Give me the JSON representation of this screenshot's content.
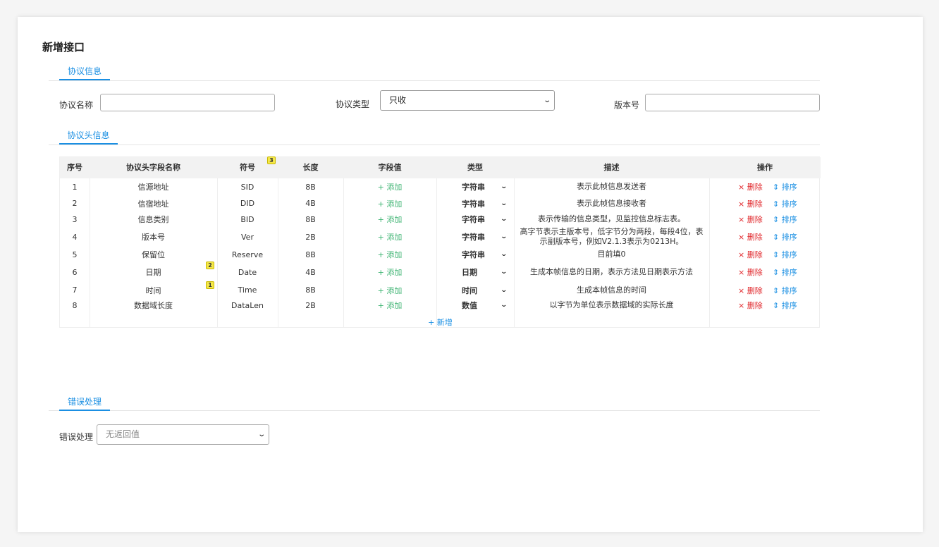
{
  "page_title": "新增接口",
  "sections": {
    "protocol_info": "协议信息",
    "protocol_header": "协议头信息",
    "error_handling": "错误处理"
  },
  "form": {
    "name_label": "协议名称",
    "name_value": "",
    "type_label": "协议类型",
    "type_value": "只收",
    "version_label": "版本号",
    "version_value": "",
    "error_label": "错误处理",
    "error_value": "无返回值"
  },
  "table": {
    "headers": [
      "序号",
      "协议头字段名称",
      "符号",
      "长度",
      "字段值",
      "类型",
      "描述",
      "操作"
    ],
    "add_label": "+ 添加",
    "delete_label": "× 删除",
    "sort_label": "⇕ 排序",
    "new_label": "+ 新增",
    "rows": [
      {
        "no": "1",
        "name": "信源地址",
        "symbol": "SID",
        "length": "8B",
        "type": "字符串",
        "desc": "表示此帧信息发送者"
      },
      {
        "no": "2",
        "name": "信宿地址",
        "symbol": "DID",
        "length": "4B",
        "type": "字符串",
        "desc": "表示此帧信息接收者"
      },
      {
        "no": "3",
        "name": "信息类别",
        "symbol": "BID",
        "length": "8B",
        "type": "字符串",
        "desc": "表示传输的信息类型，见监控信息标志表。"
      },
      {
        "no": "4",
        "name": "版本号",
        "symbol": "Ver",
        "length": "2B",
        "type": "字符串",
        "desc": "高字节表示主版本号，低字节分为两段，每段4位，表示副版本号，例如V2.1.3表示为0213H。"
      },
      {
        "no": "5",
        "name": "保留位",
        "symbol": "Reserve",
        "length": "8B",
        "type": "字符串",
        "desc": "目前填0"
      },
      {
        "no": "6",
        "name": "日期",
        "symbol": "Date",
        "length": "4B",
        "type": "日期",
        "desc": "生成本帧信息的日期，表示方法见日期表示方法"
      },
      {
        "no": "7",
        "name": "时间",
        "symbol": "Time",
        "length": "8B",
        "type": "时间",
        "desc": "生成本帧信息的时间"
      },
      {
        "no": "8",
        "name": "数据域长度",
        "symbol": "DataLen",
        "length": "2B",
        "type": "数值",
        "desc": "以字节为单位表示数据域的实际长度"
      }
    ]
  },
  "badges": [
    "1",
    "2",
    "3"
  ]
}
